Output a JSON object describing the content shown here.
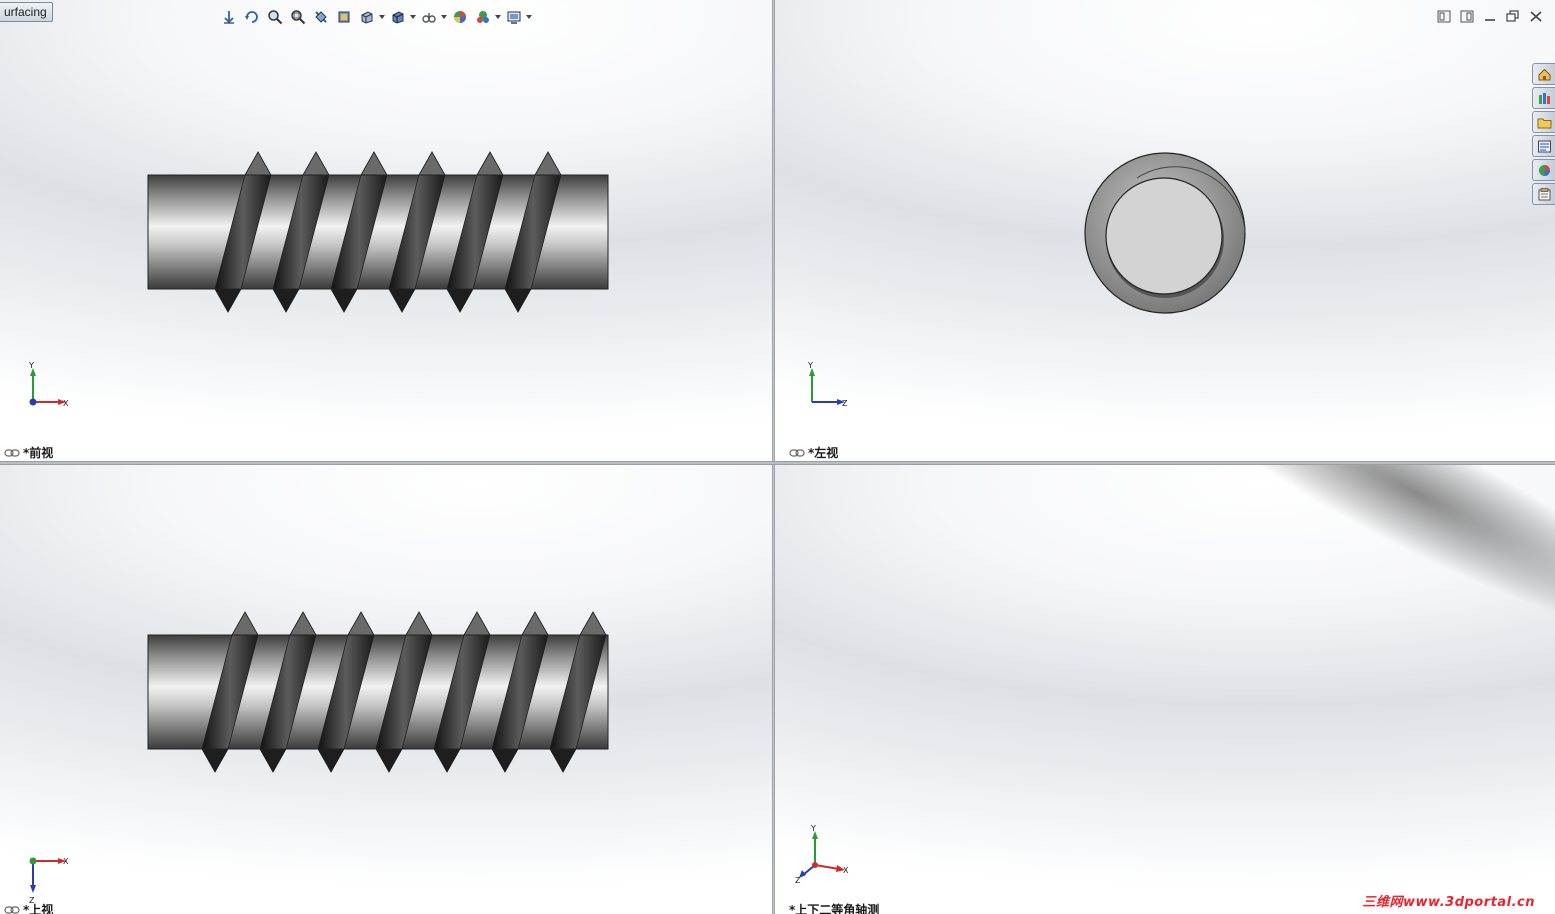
{
  "tab": {
    "label": "urfacing"
  },
  "heads_up_toolbar": {
    "icons": [
      "previous-view-icon",
      "rotate-view-icon",
      "zoom-to-fit-icon",
      "zoom-to-area-icon",
      "section-view-icon",
      "view-orientation-icon",
      "display-style-icon",
      "hide-show-items-icon",
      "edit-appearance-icon",
      "apply-scene-icon",
      "view-settings-icon"
    ]
  },
  "window_controls": {
    "icons": [
      "tile-horizontal-icon",
      "tile-vertical-icon",
      "minimize-icon",
      "restore-icon",
      "close-icon"
    ]
  },
  "task_pane": {
    "icons": [
      "solidworks-resources-icon",
      "design-library-icon",
      "file-explorer-icon",
      "view-palette-icon",
      "appearances-scenes-icon",
      "custom-properties-icon"
    ]
  },
  "viewports": {
    "front": {
      "label": "*前视",
      "axis_h": "X",
      "axis_v": "Y"
    },
    "left": {
      "label": "*左视",
      "axis_h": "Z",
      "axis_v": "Y"
    },
    "top": {
      "label": "*上视",
      "axis_h": "X",
      "axis_v": "Z"
    },
    "iso": {
      "label": "*上下二等角轴测",
      "axis_x": "X",
      "axis_y": "Y",
      "axis_z": "Z"
    }
  },
  "watermark": {
    "text": "三维网www.3dportal.cn"
  },
  "colors": {
    "axis_x": "#d12a2a",
    "axis_y": "#2a9a3a",
    "axis_z": "#2a3ab5",
    "accent_watermark": "#e8252f"
  }
}
